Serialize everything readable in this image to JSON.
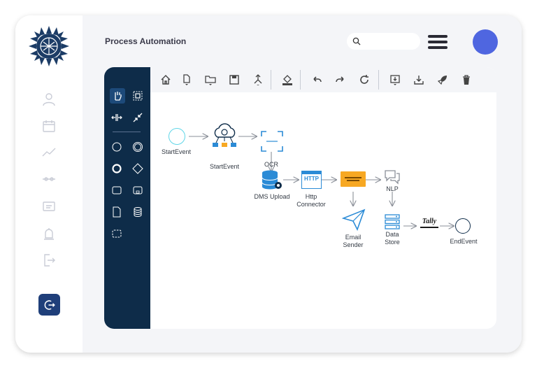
{
  "header": {
    "title": "Process Automation",
    "search_placeholder": ""
  },
  "left_rail": {
    "icons": [
      "user-icon",
      "calendar-icon",
      "chart-icon",
      "slider-icon",
      "message-icon",
      "alarm-icon",
      "exit-icon"
    ],
    "logout_icon": "logout-icon"
  },
  "toolbar": {
    "icons": [
      "home-icon",
      "file-icon",
      "folder-icon",
      "save-icon",
      "merge-icon",
      "fill-icon",
      "undo-icon",
      "redo-icon",
      "refresh-icon",
      "import-icon",
      "download-icon",
      "rocket-icon",
      "trash-icon"
    ]
  },
  "palette": {
    "icons": [
      "hand-tool-icon",
      "lasso-icon",
      "space-tool-icon",
      "connect-icon",
      "start-event-icon",
      "intermediate-event-icon",
      "end-event-icon",
      "gateway-icon",
      "task-icon",
      "subprocess-icon",
      "data-object-icon",
      "data-store-icon",
      "group-icon"
    ]
  },
  "diagram": {
    "nodes": {
      "start": "StartEvent",
      "cloud": "StartEvent",
      "ocr": "OCR",
      "dms": "DMS Upload",
      "http_line1": "Http",
      "http_line2": "Connector",
      "http_badge": "HTTP",
      "mail": "Email",
      "mail2": "Sender",
      "nlp": "NLP",
      "datastore_line1": "Data",
      "datastore_line2": "Store",
      "tally": "Tally",
      "end": "EndEvent"
    },
    "colors": {
      "start_event": "#5fd6e8",
      "accent": "#2b8bd6",
      "dark": "#0e2c49",
      "orange": "#f7a823"
    }
  }
}
